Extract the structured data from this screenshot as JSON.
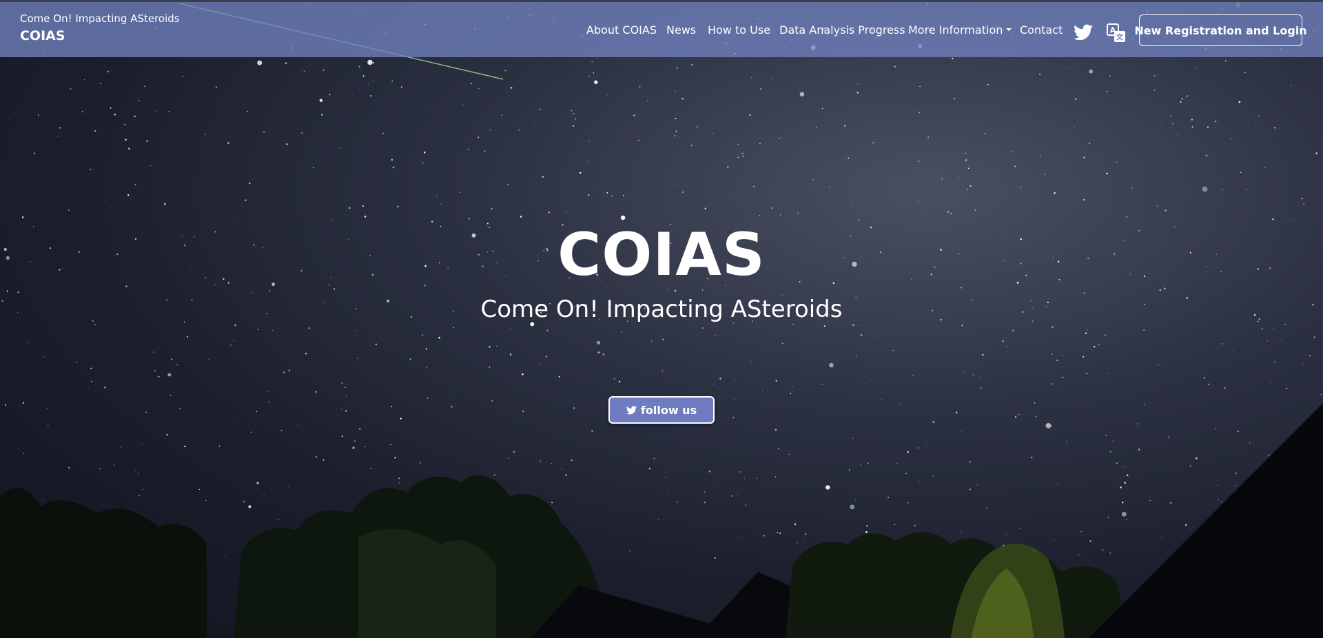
{
  "header": {
    "brand_tagline": "Come On! Impacting ASteroids",
    "brand_name": "COIAS",
    "nav": [
      {
        "label": "About COIAS"
      },
      {
        "label": "News"
      },
      {
        "label": "How to Use"
      },
      {
        "label": "Data Analysis Progress"
      },
      {
        "label": "More Information",
        "has_dropdown": true
      },
      {
        "label": "Contact"
      }
    ],
    "icons": {
      "twitter": "twitter-icon",
      "translate": "translate-icon"
    },
    "login_label": "New Registration and Login"
  },
  "hero": {
    "title": "COIAS",
    "subtitle": "Come On! Impacting ASteroids",
    "follow_label": "follow us",
    "follow_icon": "twitter-icon"
  },
  "colors": {
    "navbar": "#7080be",
    "follow_button": "#6f7cc0",
    "text": "#ffffff"
  }
}
